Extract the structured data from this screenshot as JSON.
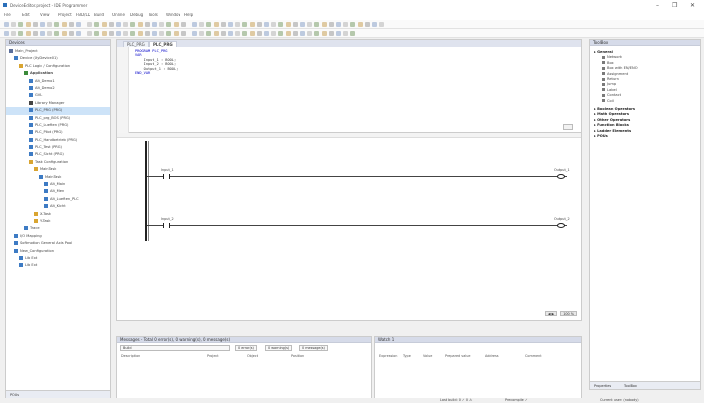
{
  "window": {
    "title": "DeviceEditor.project - IDE Programmer",
    "controls": {
      "minimize": "–",
      "maximize": "❐",
      "close": "✕"
    }
  },
  "menu": [
    "File",
    "Edit",
    "View",
    "Project",
    "FBD/LD/IL",
    "Build",
    "Online",
    "Debug",
    "Tools",
    "Window",
    "Help"
  ],
  "devices_panel": {
    "title": "Devices",
    "tree": [
      {
        "label": "Main_Project",
        "indent": 0,
        "icon": "project-icon",
        "color": "#5b6f9b"
      },
      {
        "label": "Device (XyDevice01)",
        "indent": 1,
        "icon": "device-icon",
        "color": "#3d7bc4"
      },
      {
        "label": "PLC Logic / Configuration",
        "indent": 2,
        "icon": "plc-logic-icon",
        "color": "#d9a531"
      },
      {
        "label": "Application",
        "indent": 3,
        "icon": "application-icon",
        "color": "#3a8a3a",
        "bold": true
      },
      {
        "label": "Alt_Demo1",
        "indent": 4,
        "icon": "pou-icon",
        "color": "#3d7bc4"
      },
      {
        "label": "Alt_Demo2",
        "indent": 4,
        "icon": "pou-icon",
        "color": "#3d7bc4"
      },
      {
        "label": "GVL",
        "indent": 4,
        "icon": "gvl-icon",
        "color": "#3d7bc4"
      },
      {
        "label": "Library Manager",
        "indent": 4,
        "icon": "library-icon",
        "color": "#444"
      },
      {
        "label": "PLC_PRG (PRG)",
        "indent": 4,
        "icon": "pou-icon",
        "color": "#3d7bc4",
        "selected": true
      },
      {
        "label": "PLC_prg_BOS (PRG)",
        "indent": 4,
        "icon": "pou-icon",
        "color": "#3d7bc4"
      },
      {
        "label": "PLC_Lueften (PRG)",
        "indent": 4,
        "icon": "pou-icon",
        "color": "#3d7bc4"
      },
      {
        "label": "PLC_Pilot (PRG)",
        "indent": 4,
        "icon": "pou-icon",
        "color": "#3d7bc4"
      },
      {
        "label": "PLC_Handbetrieb (PRG)",
        "indent": 4,
        "icon": "pou-icon",
        "color": "#3d7bc4"
      },
      {
        "label": "PLC_Test (PRG)",
        "indent": 4,
        "icon": "pou-icon",
        "color": "#3d7bc4"
      },
      {
        "label": "PLC_Sicht (PRG)",
        "indent": 4,
        "icon": "pou-icon",
        "color": "#3d7bc4"
      },
      {
        "label": "Task Configuration",
        "indent": 4,
        "icon": "task-config-icon",
        "color": "#d9a531"
      },
      {
        "label": "MainTask",
        "indent": 5,
        "icon": "task-icon",
        "color": "#d9a531"
      },
      {
        "label": "MainTask",
        "indent": 6,
        "icon": "task-icon",
        "color": "#3d7bc4"
      },
      {
        "label": "Alt_Main",
        "indent": 7,
        "icon": "call-icon",
        "color": "#3d7bc4"
      },
      {
        "label": "Alt_Men",
        "indent": 7,
        "icon": "call-icon",
        "color": "#3d7bc4"
      },
      {
        "label": "Alt_Lueften_PLC",
        "indent": 7,
        "icon": "call-icon",
        "color": "#3d7bc4"
      },
      {
        "label": "Alt_Kicht",
        "indent": 7,
        "icon": "call-icon",
        "color": "#3d7bc4"
      },
      {
        "label": "X-Task",
        "indent": 5,
        "icon": "task-icon",
        "color": "#d9a531"
      },
      {
        "label": "Y-Task",
        "indent": 5,
        "icon": "task-icon",
        "color": "#d9a531"
      },
      {
        "label": "Trace",
        "indent": 3,
        "icon": "trace-icon",
        "color": "#3d7bc4"
      },
      {
        "label": "I/O Mapping",
        "indent": 1,
        "icon": "io-icon",
        "color": "#3d7bc4"
      },
      {
        "label": "Softmotion General Axis Pool",
        "indent": 1,
        "icon": "axis-icon",
        "color": "#3d7bc4"
      },
      {
        "label": "New_Configuration",
        "indent": 1,
        "icon": "config-icon",
        "color": "#3d7bc4"
      },
      {
        "label": "Lib Ext",
        "indent": 2,
        "icon": "ext-icon",
        "color": "#3d7bc4"
      },
      {
        "label": "Lib Ext",
        "indent": 2,
        "icon": "ext-icon",
        "color": "#3d7bc4"
      }
    ],
    "footer_tab": "POUs"
  },
  "editor": {
    "tabs": [
      {
        "label": "PLC_PRG",
        "active": false
      },
      {
        "label": "PLC_PRG",
        "active": true
      }
    ],
    "declaration": [
      {
        "t": "PROGRAM PLC_PRG",
        "kw": true
      },
      {
        "t": "VAR",
        "kw": true
      },
      {
        "t": "    Input_1 : BOOL;",
        "kw": false
      },
      {
        "t": "    Input_2 : BOOL;",
        "kw": false
      },
      {
        "t": "    Output_1 : BOOL;",
        "kw": false
      },
      {
        "t": "END_VAR",
        "kw": true
      }
    ],
    "rungs": [
      {
        "contact": "Input_1",
        "coil": "Output_1"
      },
      {
        "contact": "Input_2",
        "coil": "Output_2"
      }
    ],
    "zoom_buttons": [
      "◀ ▶",
      "100 %"
    ]
  },
  "toolbox": {
    "title": "ToolBox",
    "items": [
      {
        "label": "General",
        "type": "cat"
      },
      {
        "label": "Network",
        "type": "sub"
      },
      {
        "label": "Box",
        "type": "sub"
      },
      {
        "label": "Box with EN/ENO",
        "type": "sub"
      },
      {
        "label": "Assignment",
        "type": "sub"
      },
      {
        "label": "Return",
        "type": "sub"
      },
      {
        "label": "Jump",
        "type": "sub"
      },
      {
        "label": "Label",
        "type": "sub"
      },
      {
        "label": "Contact",
        "type": "sub"
      },
      {
        "label": "Coil",
        "type": "sub"
      },
      {
        "label": "Boolean Operators",
        "type": "cat"
      },
      {
        "label": "Math Operators",
        "type": "cat"
      },
      {
        "label": "Other Operators",
        "type": "cat"
      },
      {
        "label": "Function Blocks",
        "type": "cat"
      },
      {
        "label": "Ladder Elements",
        "type": "cat"
      },
      {
        "label": "POUs",
        "type": "cat"
      }
    ],
    "footer_tabs": [
      "Properties",
      "ToolBox"
    ]
  },
  "messages": {
    "title": "Messages - Total 0 error(s), 0 warning(s), 0 message(s)",
    "filter_label": "Build",
    "counts": [
      "0 error(s)",
      "0 warning(s)",
      "0 message(s)"
    ],
    "columns": [
      "Description",
      "Project",
      "Object",
      "Position"
    ]
  },
  "watch": {
    "title": "Watch 1",
    "columns": [
      "Expression",
      "Type",
      "Value",
      "Prepared value",
      "Address",
      "Comment"
    ]
  },
  "statusbar": {
    "left": "Last build: 0 ✓ 0 ⚠",
    "middle": "Precompile ✓",
    "right": "Current user: (nobody)"
  }
}
